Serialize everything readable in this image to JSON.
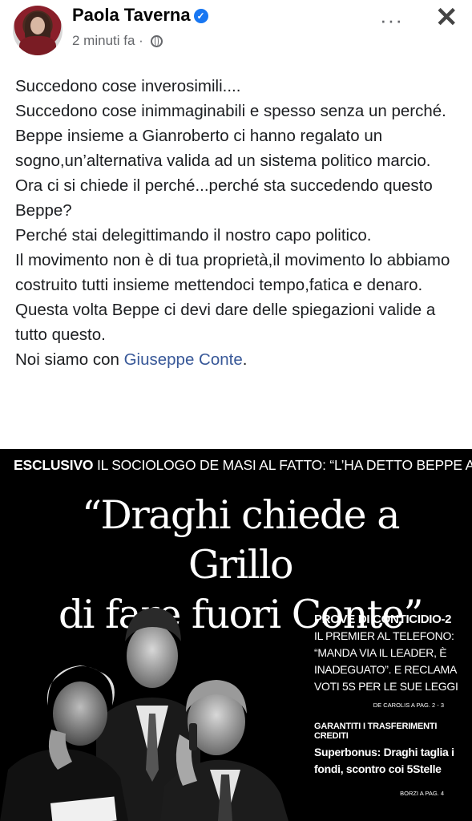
{
  "post": {
    "author": "Paola Taverna",
    "time": "2 minuti fa",
    "dot": "·",
    "more_glyph": "···",
    "close_glyph": "✕",
    "check_glyph": "✓",
    "lines": [
      "Succedono cose inverosimili....",
      "Succedono cose inimmaginabili e spesso senza un perché.",
      "Beppe insieme a Gianroberto ci hanno regalato un sogno,un’alternativa valida ad un sistema politico marcio.",
      "Ora ci si chiede il perché...perché sta succedendo questo Beppe?",
      "Perché stai delegittimando il nostro capo politico.",
      "Il movimento non è di tua proprietà,il movimento lo abbiamo costruito tutti insieme mettendoci tempo,fatica e denaro.",
      "Questa volta Beppe ci devi dare delle spiegazioni valide a tutto questo."
    ],
    "last_prefix": "Noi siamo con ",
    "last_link": "Giuseppe Conte",
    "last_suffix": "."
  },
  "image": {
    "strap_bold": "ESCLUSIVO",
    "strap_rest": " IL SOCIOLOGO DE MASI AL FATTO: “L’HA DETTO BEPPE A ME E AI DEPUTATI”",
    "headline_1": "“Draghi chiede a Grillo",
    "headline_2": "di fare fuori Conte”",
    "side_title": "PROVE DI CONTICIDIO-2",
    "side_body": "IL PREMIER AL TELEFONO: “MANDA VIA IL LEADER, È INADEGUATO”. E RECLAMA VOTI 5S PER LE SUE LEGGI",
    "side_ref": "DE CAROLIS A PAG. 2 - 3",
    "side_kicker": "GARANTITI I TRASFERIMENTI CREDITI",
    "side_title2": "Superbonus: Draghi taglia i fondi, scontro coi 5Stelle",
    "side_ref2": "BORZI A PAG. 4"
  },
  "colors": {
    "link": "#385898",
    "verified": "#1877f2",
    "meta": "#65676b"
  }
}
